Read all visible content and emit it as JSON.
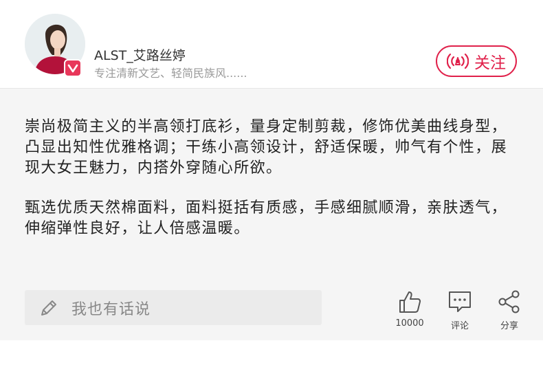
{
  "author": {
    "name": "ALST_艾路丝婷",
    "tagline": "专注清新文艺、轻简民族风......",
    "avatar_icon": "avatar-photo",
    "badge_icon": "verified-v-icon"
  },
  "follow_button": {
    "label": "关注",
    "icon": "broadcast-icon",
    "color": "#e0204a"
  },
  "description": {
    "paragraph1": "崇尚极简主义的半高领打底衫，量身定制剪裁，修饰优美曲线身型，凸显出知性优雅格调；干练小高领设计，舒适保暖，帅气有个性，展现大女王魅力，内搭外穿随心所欲。",
    "paragraph2": "甄选优质天然棉面料，面料挺括有质感，手感细腻顺滑，亲肤透气，伸缩弹性良好，让人倍感温暖。"
  },
  "comment_input": {
    "placeholder": "我也有话说",
    "icon": "pencil-icon"
  },
  "actions": {
    "like": {
      "count": "10000",
      "icon": "thumbs-up-icon"
    },
    "comment": {
      "label": "评论",
      "icon": "comment-bubble-icon"
    },
    "share": {
      "label": "分享",
      "icon": "share-icon"
    }
  }
}
